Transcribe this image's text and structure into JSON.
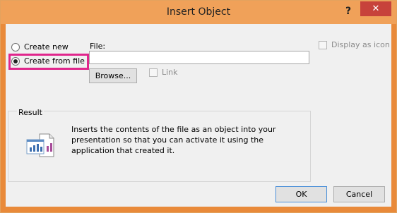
{
  "window": {
    "title": "Insert Object"
  },
  "titlebar": {
    "help_label": "?",
    "close_label": "✕"
  },
  "options": {
    "create_new_label": "Create new",
    "create_from_file_label": "Create from file",
    "selected": "Create from file"
  },
  "file": {
    "label": "File:",
    "value": "",
    "browse_label": "Browse...",
    "link_label": "Link"
  },
  "display_as_icon_label": "Display as icon",
  "result": {
    "label": "Result",
    "text": "Inserts the contents of the file as an object into your presentation so that you can activate it using the application that created it.",
    "icon": "file-object-chart-icon"
  },
  "buttons": {
    "ok_label": "OK",
    "cancel_label": "Cancel"
  },
  "colors": {
    "titlebar": "#f0a159",
    "close": "#c7423b",
    "highlight": "#e0268c"
  }
}
